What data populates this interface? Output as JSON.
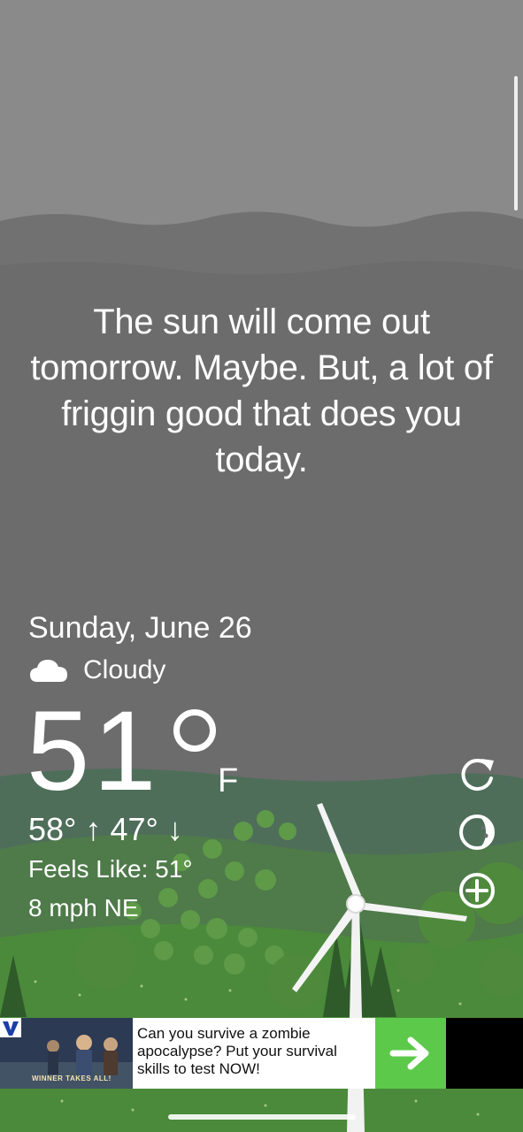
{
  "quote": "The sun will come out tomorrow. Maybe. But, a lot of friggin good that does you today.",
  "weather": {
    "date": "Sunday, June 26",
    "condition": "Cloudy",
    "condition_icon": "cloud-icon",
    "temperature": "51",
    "unit": "F",
    "high_low": "58° ↑ 47° ↓",
    "feels_like": "Feels Like: 51°",
    "wind": "8 mph NE"
  },
  "actions": {
    "refresh_icon": "refresh-icon",
    "moon_icon": "moon-phase-icon",
    "add_icon": "add-location-icon"
  },
  "ad": {
    "image_caption": "WINNER TAKES ALL!",
    "text": "Can you survive a zombie apocalypse? Put your survival skills to test NOW!",
    "cta_icon": "arrow-right-icon"
  },
  "colors": {
    "sky": "#6c6c6c",
    "hills": "#4e6e5a",
    "grass": "#4a8a3a",
    "ad_cta": "#5cc94a"
  }
}
